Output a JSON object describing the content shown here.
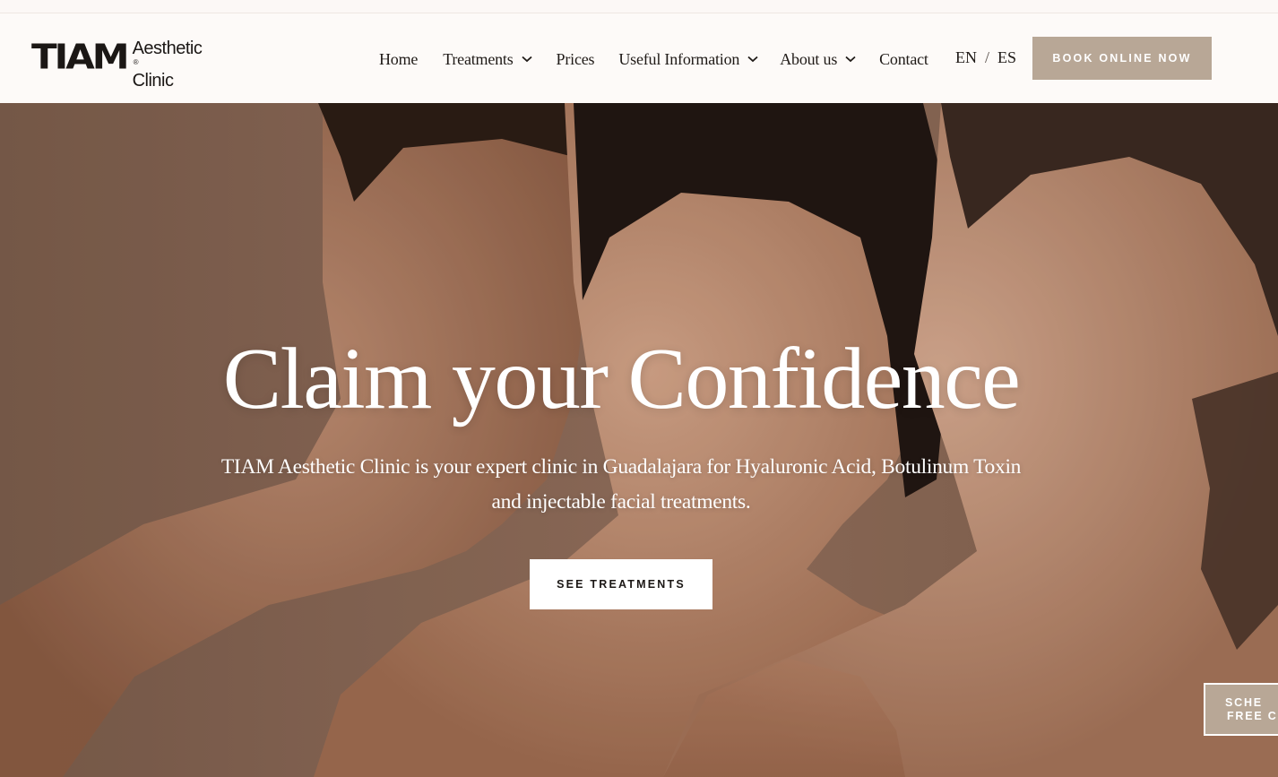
{
  "brand": {
    "mark": "TIAM",
    "line1": "Aesthetic",
    "line2": "Clinic",
    "reg": "®"
  },
  "nav": {
    "items": [
      {
        "label": "Home",
        "dropdown": false
      },
      {
        "label": "Treatments",
        "dropdown": true
      },
      {
        "label": "Prices",
        "dropdown": false
      },
      {
        "label": "Useful Information",
        "dropdown": true
      },
      {
        "label": "About us",
        "dropdown": true
      },
      {
        "label": "Contact",
        "dropdown": false
      }
    ],
    "lang_en": "EN",
    "lang_sep": "/",
    "lang_es": "ES",
    "book_label": "BOOK ONLINE NOW"
  },
  "hero": {
    "title": "Claim your Confidence",
    "subtitle_line1": "TIAM Aesthetic Clinic is your expert clinic in Guadalajara for Hyaluronic Acid, Botulinum Toxin",
    "subtitle_line2": "and injectable facial treatments.",
    "cta_label": "SEE TREATMENTS",
    "side_cta_line1": "SCHE",
    "side_cta_line2": "FREE CO"
  },
  "colors": {
    "accent": "#b8a796",
    "header_bg": "#fdfaf8",
    "text_dark": "#1f1a17",
    "hero_bg": "#8b6a58"
  },
  "icons": {
    "dropdown": "chevron-down-icon"
  }
}
